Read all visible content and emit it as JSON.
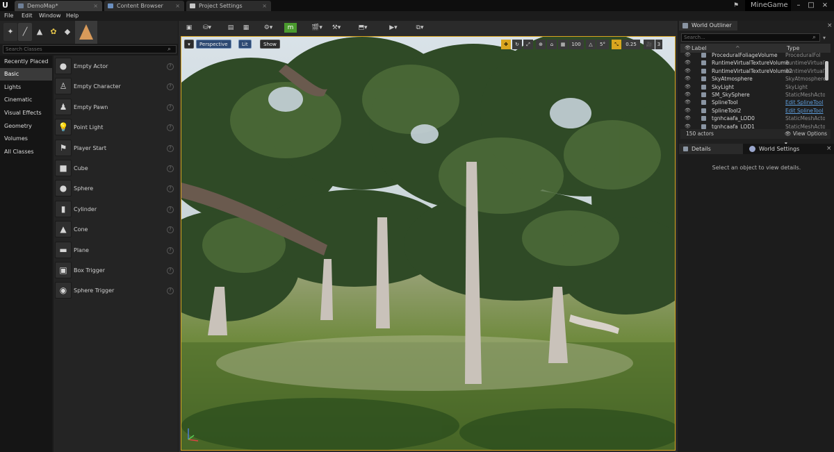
{
  "titlebar": {
    "tabs": [
      "DemoMap*",
      "Content Browser",
      "Project Settings"
    ],
    "project_name": "MineGame"
  },
  "menubar": [
    "File",
    "Edit",
    "Window",
    "Help"
  ],
  "place_mode": {
    "search_placeholder": "Search Classes",
    "categories": [
      "Recently Placed",
      "Basic",
      "Lights",
      "Cinematic",
      "Visual Effects",
      "Geometry",
      "Volumes",
      "All Classes"
    ],
    "selected_category": "Basic",
    "actors": [
      {
        "label": "Empty Actor",
        "icon": "sphere-icon"
      },
      {
        "label": "Empty Character",
        "icon": "character-icon"
      },
      {
        "label": "Empty Pawn",
        "icon": "pawn-icon"
      },
      {
        "label": "Point Light",
        "icon": "bulb-icon"
      },
      {
        "label": "Player Start",
        "icon": "flag-icon"
      },
      {
        "label": "Cube",
        "icon": "cube-icon"
      },
      {
        "label": "Sphere",
        "icon": "sphere-icon"
      },
      {
        "label": "Cylinder",
        "icon": "cylinder-icon"
      },
      {
        "label": "Cone",
        "icon": "cone-icon"
      },
      {
        "label": "Plane",
        "icon": "plane-icon"
      },
      {
        "label": "Box Trigger",
        "icon": "box-trigger-icon"
      },
      {
        "label": "Sphere Trigger",
        "icon": "sphere-trigger-icon"
      }
    ]
  },
  "viewport": {
    "view_mode": "Perspective",
    "lighting": "Lit",
    "show": "Show",
    "grid_snap": "100",
    "rotation_snap": "5°",
    "scale_snap": "0.25",
    "camera_speed": "3",
    "accent": "#d9a51f"
  },
  "world_outliner": {
    "tab_title": "World Outliner",
    "search_placeholder": "Search...",
    "col_label": "Label",
    "col_type": "Type",
    "rows": [
      {
        "label": "ProceduralFoliageVolume",
        "type": "ProceduralFol",
        "link": false
      },
      {
        "label": "RuntimeVirtualTextureVolume",
        "type": "RuntimeVirtualT",
        "link": false
      },
      {
        "label": "RuntimeVirtualTextureVolume2",
        "type": "RuntimeVirtualT",
        "link": false
      },
      {
        "label": "SkyAtmosphere",
        "type": "SkyAtmosphere",
        "link": false
      },
      {
        "label": "SkyLight",
        "type": "SkyLight",
        "link": false
      },
      {
        "label": "SM_SkySphere",
        "type": "StaticMeshActor",
        "link": false
      },
      {
        "label": "SplineTool",
        "type": "Edit SplineTool",
        "link": true
      },
      {
        "label": "SplineTool2",
        "type": "Edit SplineTool",
        "link": true
      },
      {
        "label": "tgnhcaafa_LOD0",
        "type": "StaticMeshActor",
        "link": false
      },
      {
        "label": "tgnhcaafa_LOD1",
        "type": "StaticMeshActor",
        "link": false
      }
    ],
    "actor_count": "150 actors",
    "view_options": "View Options"
  },
  "details": {
    "tab_details": "Details",
    "tab_world_settings": "World Settings",
    "empty_message": "Select an object to view details."
  }
}
